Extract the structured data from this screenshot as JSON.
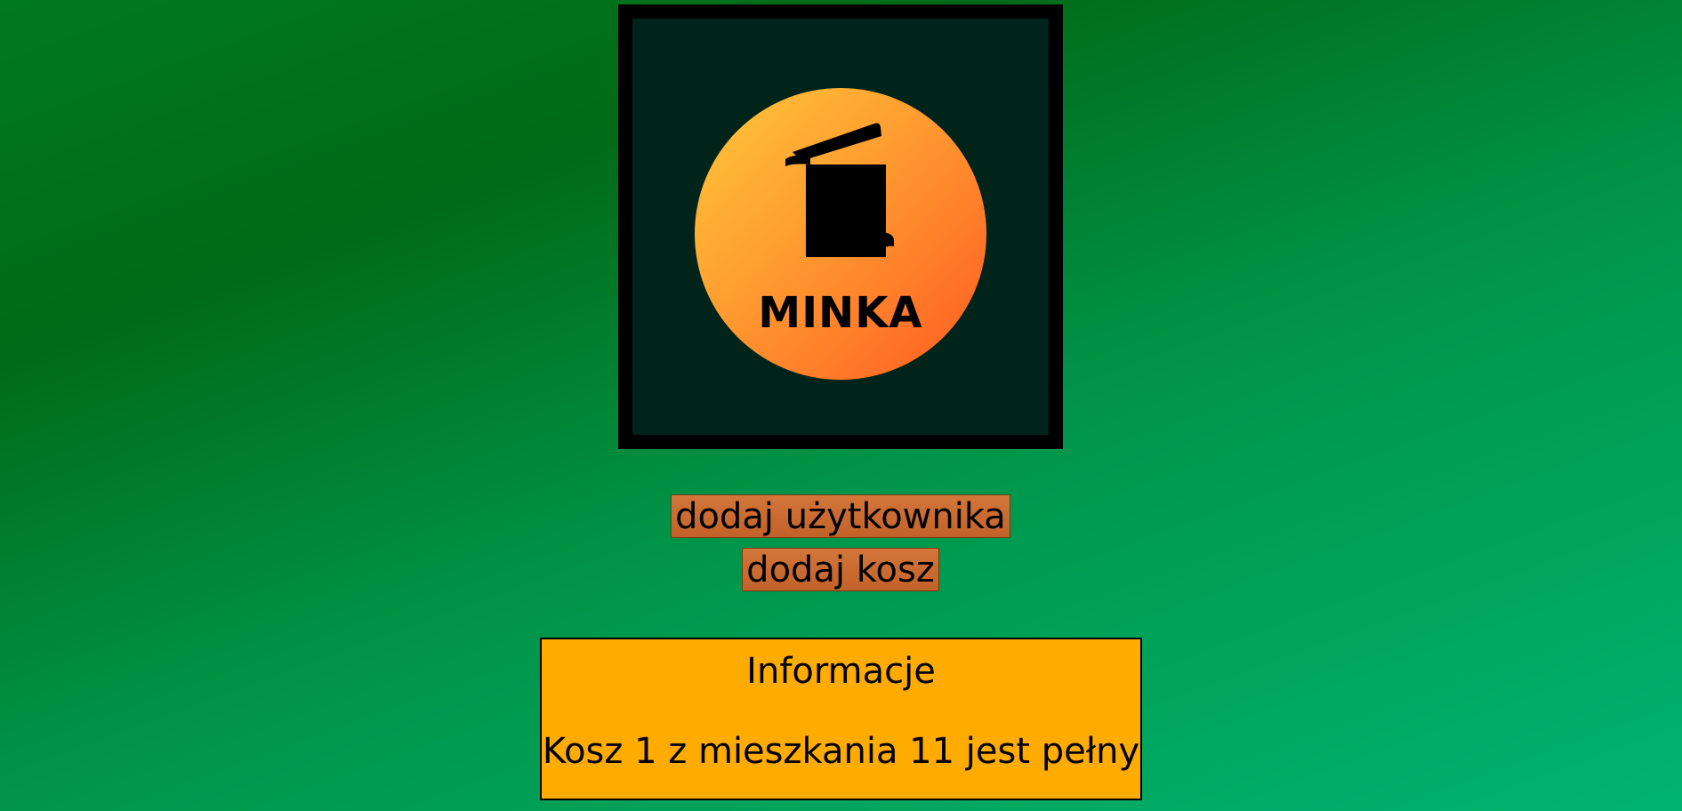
{
  "logo": {
    "text": "MINKA",
    "icon": "trash-bin-icon",
    "colors": {
      "frame": "#000000",
      "frame_bg": "#00231a",
      "circle_start": "#ffc83a",
      "circle_end": "#ff5a22"
    }
  },
  "actions": {
    "add_user_label": "dodaj użytkownika",
    "add_bin_label": "dodaj kosz"
  },
  "info": {
    "title": "Informacje",
    "message": "Kosz 1 z mieszkania 11 jest pełny"
  },
  "colors": {
    "button": "#c8692f",
    "info_bg": "#ffab00",
    "background_start": "#007a1e",
    "background_end": "#00b470"
  }
}
